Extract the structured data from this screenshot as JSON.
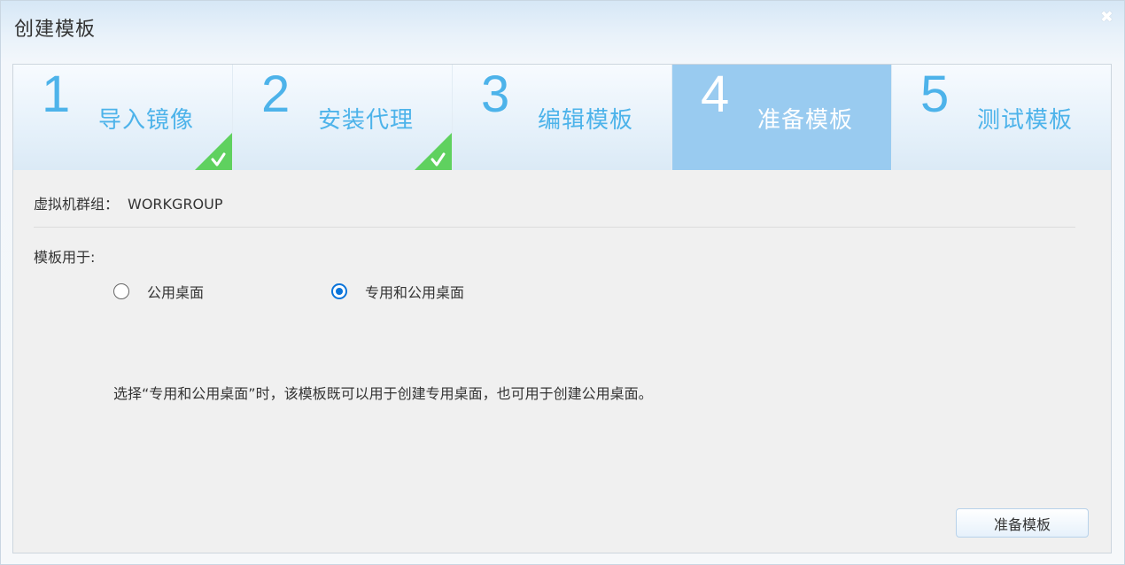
{
  "window": {
    "title": "创建模板",
    "close_glyph": "✖"
  },
  "steps": [
    {
      "num": "1",
      "label": "导入镜像",
      "state": "done"
    },
    {
      "num": "2",
      "label": "安装代理",
      "state": "done"
    },
    {
      "num": "3",
      "label": "编辑模板",
      "state": "pending"
    },
    {
      "num": "4",
      "label": "准备模板",
      "state": "active"
    },
    {
      "num": "5",
      "label": "测试模板",
      "state": "pending"
    }
  ],
  "form": {
    "group_label": "虚拟机群组：",
    "group_value": "WORKGROUP",
    "use_label": "模板用于:",
    "options": [
      {
        "label": "公用桌面",
        "checked": false
      },
      {
        "label": "专用和公用桌面",
        "checked": true
      }
    ],
    "note": "选择“专用和公用桌面”时，该模板既可以用于创建专用桌面，也可用于创建公用桌面。"
  },
  "actions": {
    "submit_label": "准备模板"
  },
  "colors": {
    "step_text": "#4db3ea",
    "active_step_bg": "#99cbf0",
    "check_green": "#5fd15f",
    "radio_accent": "#0a74da"
  }
}
